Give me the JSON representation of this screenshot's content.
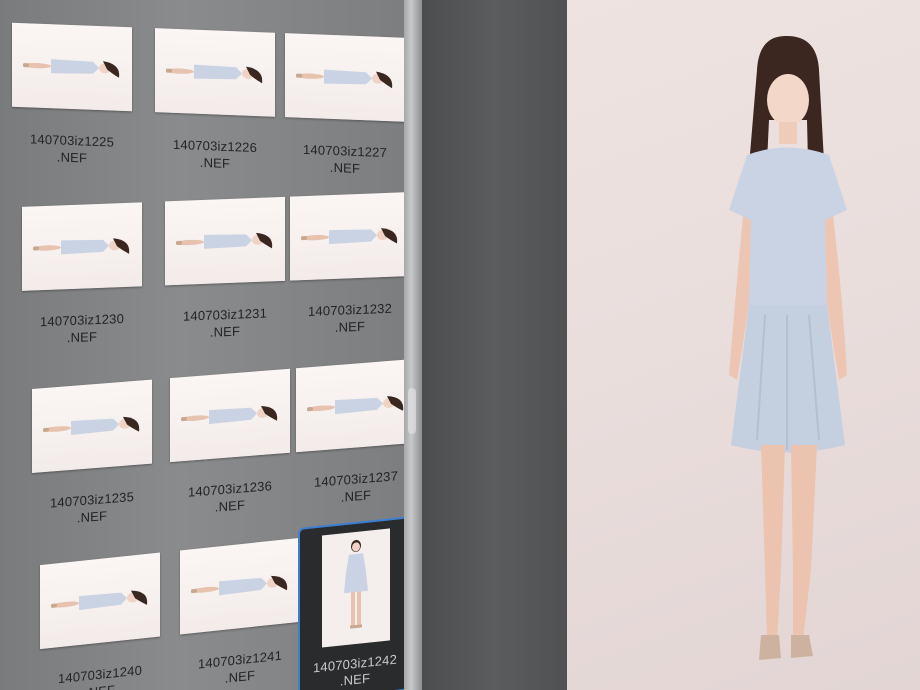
{
  "browser": {
    "rows": [
      {
        "items": [
          {
            "name": "140703iz1225",
            "ext": ".NEF"
          },
          {
            "name": "140703iz1226",
            "ext": ".NEF"
          },
          {
            "name": "140703iz1227",
            "ext": ".NEF"
          }
        ]
      },
      {
        "items": [
          {
            "name": "140703iz1230",
            "ext": ".NEF"
          },
          {
            "name": "140703iz1231",
            "ext": ".NEF"
          },
          {
            "name": "140703iz1232",
            "ext": ".NEF"
          }
        ]
      },
      {
        "items": [
          {
            "name": "140703iz1235",
            "ext": ".NEF"
          },
          {
            "name": "140703iz1236",
            "ext": ".NEF"
          },
          {
            "name": "140703iz1237",
            "ext": ".NEF"
          }
        ]
      },
      {
        "items": [
          {
            "name": "140703iz1240",
            "ext": ".NEF"
          },
          {
            "name": "140703iz1241",
            "ext": ".NEF"
          },
          {
            "name": "140703iz1242",
            "ext": ".NEF",
            "selected": true
          }
        ]
      }
    ]
  },
  "colors": {
    "panel_gray": "#808183",
    "selection_blue": "#3c7fd1",
    "preview_background": "#ece0de",
    "dress_blue": "#c9d3e3"
  }
}
